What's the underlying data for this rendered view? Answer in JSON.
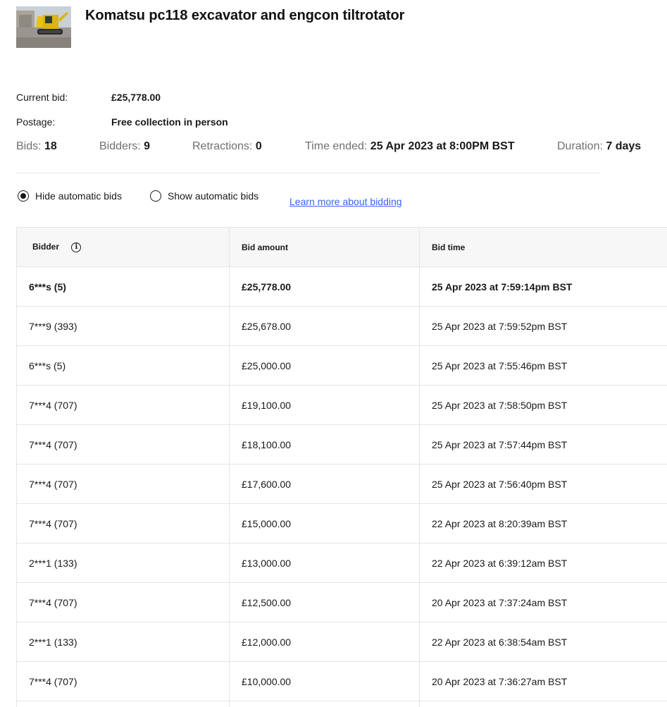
{
  "item": {
    "title": "Komatsu pc118 excavator and engcon tiltrotator"
  },
  "details": {
    "current_bid_label": "Current bid:",
    "current_bid_value": "£25,778.00",
    "postage_label": "Postage:",
    "postage_value": "Free collection in person"
  },
  "stats": {
    "bids_label": "Bids:",
    "bids_value": "18",
    "bidders_label": "Bidders:",
    "bidders_value": "9",
    "retractions_label": "Retractions:",
    "retractions_value": "0",
    "time_ended_label": "Time ended:",
    "time_ended_value": "25 Apr 2023 at 8:00PM BST",
    "duration_label": "Duration:",
    "duration_value": "7 days"
  },
  "options": {
    "hide_label": "Hide automatic bids",
    "show_label": "Show automatic bids",
    "selected": "hide",
    "learn_more": "Learn more about bidding"
  },
  "table": {
    "headers": {
      "bidder": "Bidder",
      "amount": "Bid amount",
      "time": "Bid time"
    },
    "rows": [
      {
        "bidder": "6***s (5)",
        "amount": "£25,778.00",
        "time": "25 Apr 2023 at 7:59:14pm BST"
      },
      {
        "bidder": "7***9 (393)",
        "amount": "£25,678.00",
        "time": "25 Apr 2023 at 7:59:52pm BST"
      },
      {
        "bidder": "6***s (5)",
        "amount": "£25,000.00",
        "time": "25 Apr 2023 at 7:55:46pm BST"
      },
      {
        "bidder": "7***4 (707)",
        "amount": "£19,100.00",
        "time": "25 Apr 2023 at 7:58:50pm BST"
      },
      {
        "bidder": "7***4 (707)",
        "amount": "£18,100.00",
        "time": "25 Apr 2023 at 7:57:44pm BST"
      },
      {
        "bidder": "7***4 (707)",
        "amount": "£17,600.00",
        "time": "25 Apr 2023 at 7:56:40pm BST"
      },
      {
        "bidder": "7***4 (707)",
        "amount": "£15,000.00",
        "time": "22 Apr 2023 at 8:20:39am BST"
      },
      {
        "bidder": "2***1 (133)",
        "amount": "£13,000.00",
        "time": "22 Apr 2023 at 6:39:12am BST"
      },
      {
        "bidder": "7***4 (707)",
        "amount": "£12,500.00",
        "time": "20 Apr 2023 at 7:37:24am BST"
      },
      {
        "bidder": "2***1 (133)",
        "amount": "£12,000.00",
        "time": "22 Apr 2023 at 6:38:54am BST"
      },
      {
        "bidder": "7***4 (707)",
        "amount": "£10,000.00",
        "time": "20 Apr 2023 at 7:36:27am BST"
      },
      {
        "bidder": "",
        "amount": "",
        "time": ""
      }
    ]
  }
}
